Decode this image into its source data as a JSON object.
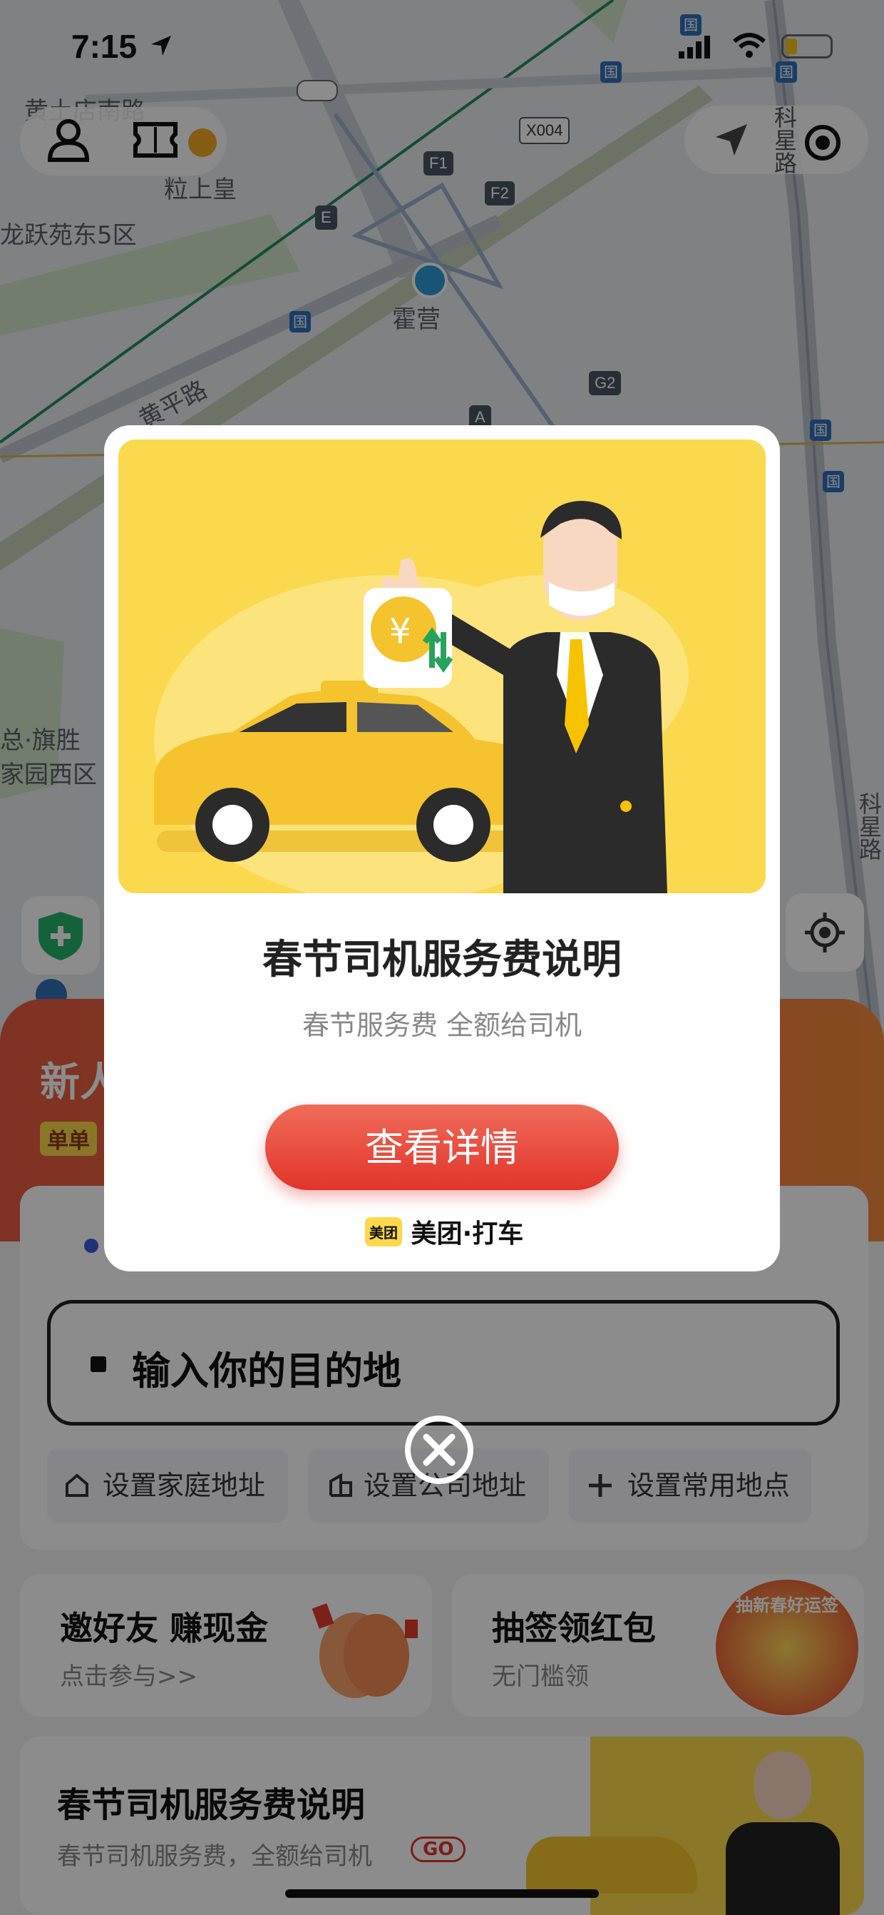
{
  "status_bar": {
    "time": "7:15"
  },
  "map": {
    "labels": [
      "黄土店南路",
      "粒上皇",
      "龙跃苑东5区",
      "霍营",
      "黄平路",
      "总·旗胜",
      "家园西区",
      "科星路",
      "科星路"
    ],
    "signs": [
      "X004",
      "F1",
      "F2",
      "E",
      "G2",
      "A"
    ]
  },
  "top_right": {
    "nav_label": "科星路"
  },
  "sheet": {
    "promo_text": "新人",
    "promo_badge": "单单",
    "destination_placeholder": "输入你的目的地",
    "quick": {
      "home": "设置家庭地址",
      "company": "设置公司地址",
      "common": "设置常用地点"
    },
    "cards": {
      "invite_title": "邀好友 赚现金",
      "invite_sub": "点击参与>>",
      "lottery_title": "抽签领红包",
      "lottery_sub": "无门槛领",
      "lottery_art_text": "抽新春好运签",
      "spring_title": "春节司机服务费说明",
      "spring_sub": "春节司机服务费，全额给司机",
      "spring_go": "GO"
    }
  },
  "modal": {
    "title": "春节司机服务费说明",
    "subtitle": "春节服务费 全额给司机",
    "button": "查看详情",
    "brand_logo": "美团",
    "brand_text": "美团·打车",
    "icon_yen": "¥"
  },
  "colors": {
    "accent_red": "#e2342a",
    "brand_yellow": "#fbd94e",
    "promo_orange": "#e8563a"
  },
  "icons": [
    "profile-icon",
    "ticket-icon",
    "navigation-arrow-icon",
    "locate-icon",
    "shield-icon",
    "close-icon",
    "home-icon",
    "building-icon",
    "plus-icon",
    "location-arrow-icon"
  ]
}
